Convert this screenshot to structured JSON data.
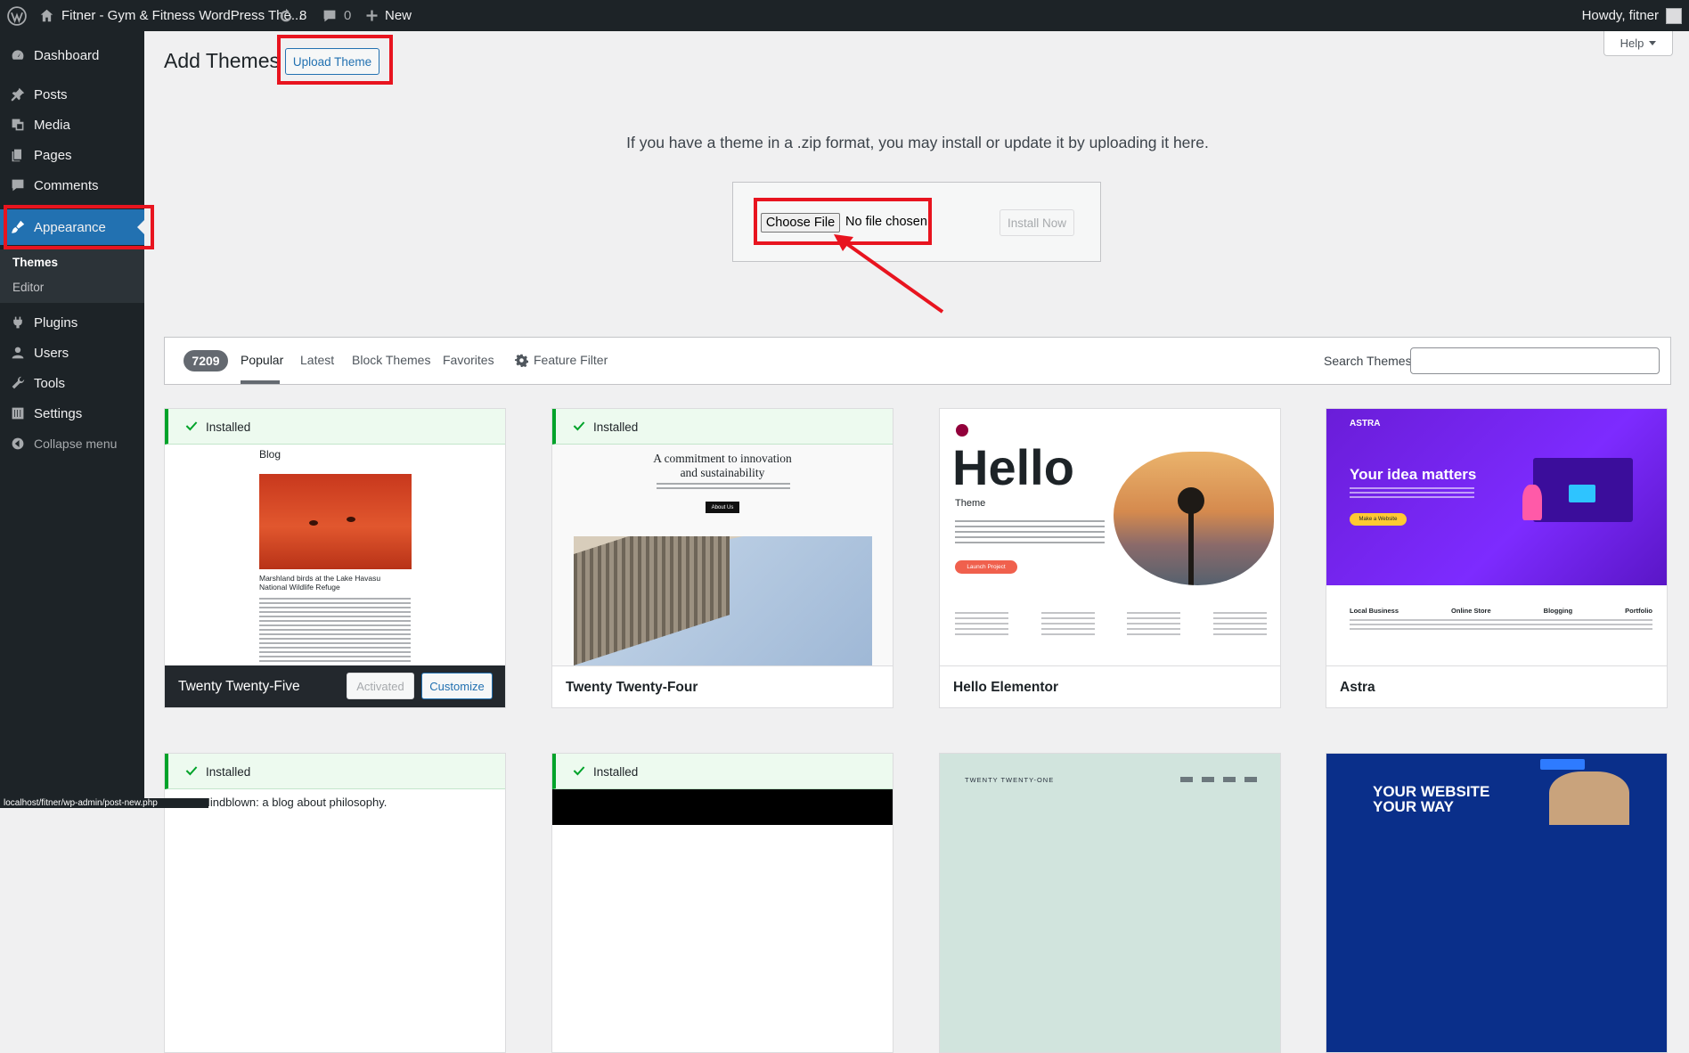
{
  "adminbar": {
    "site_name": "Fitner - Gym & Fitness WordPress The...",
    "updates_count": "8",
    "comments_count": "0",
    "new_label": "New",
    "howdy": "Howdy, fitner"
  },
  "sidebar": {
    "items": [
      {
        "label": "Dashboard",
        "icon": "dashboard-icon"
      },
      {
        "label": "Posts",
        "icon": "pin-icon"
      },
      {
        "label": "Media",
        "icon": "media-icon"
      },
      {
        "label": "Pages",
        "icon": "pages-icon"
      },
      {
        "label": "Comments",
        "icon": "comment-icon"
      },
      {
        "label": "Appearance",
        "icon": "brush-icon"
      },
      {
        "label": "Plugins",
        "icon": "plugin-icon"
      },
      {
        "label": "Users",
        "icon": "user-icon"
      },
      {
        "label": "Tools",
        "icon": "wrench-icon"
      },
      {
        "label": "Settings",
        "icon": "settings-icon"
      },
      {
        "label": "Collapse menu",
        "icon": "collapse-icon"
      }
    ],
    "submenu": [
      "Themes",
      "Editor"
    ]
  },
  "main": {
    "title": "Add Themes",
    "upload_button": "Upload Theme",
    "help_label": "Help",
    "upload_help": "If you have a theme in a .zip format, you may install or update it by uploading it here.",
    "choose_file": "Choose File",
    "no_file": "No file chosen",
    "install_now": "Install Now"
  },
  "filter": {
    "count": "7209",
    "tabs": [
      "Popular",
      "Latest",
      "Block Themes",
      "Favorites"
    ],
    "feature_filter": "Feature Filter",
    "search_label": "Search Themes"
  },
  "themes": [
    {
      "name": "Twenty Twenty-Five",
      "installed": "Installed",
      "activated": "Activated",
      "customize": "Customize",
      "preview": {
        "heading": "Blog",
        "caption": "Marshland birds at the Lake Havasu National Wildlife Refuge"
      }
    },
    {
      "name": "Twenty Twenty-Four",
      "installed": "Installed",
      "preview": {
        "heading_line1": "A commitment to innovation",
        "heading_line2": "and sustainability",
        "button": "About Us"
      }
    },
    {
      "name": "Hello Elementor",
      "preview": {
        "heading": "Hello",
        "sub": "Theme",
        "button": "Launch Project"
      }
    },
    {
      "name": "Astra",
      "preview": {
        "logo": "ASTRA",
        "heading": "Your idea matters",
        "button": "Make a Website",
        "features": [
          "Local Business",
          "Online Store",
          "Blogging",
          "Portfolio"
        ]
      }
    }
  ],
  "row2": [
    {
      "installed": "Installed",
      "preview_text": "Mindblown: a blog about philosophy."
    },
    {
      "installed": "Installed"
    },
    {
      "preview_text": "TWENTY TWENTY-ONE"
    },
    {
      "preview_text": "YOUR WEBSITE YOUR WAY"
    }
  ],
  "statusbar": "localhost/fitner/wp-admin/post-new.php",
  "colors": {
    "accent": "#2271b1",
    "sidebar": "#1d2327",
    "highlight": "#e8141f",
    "installed": "#00a32a"
  }
}
